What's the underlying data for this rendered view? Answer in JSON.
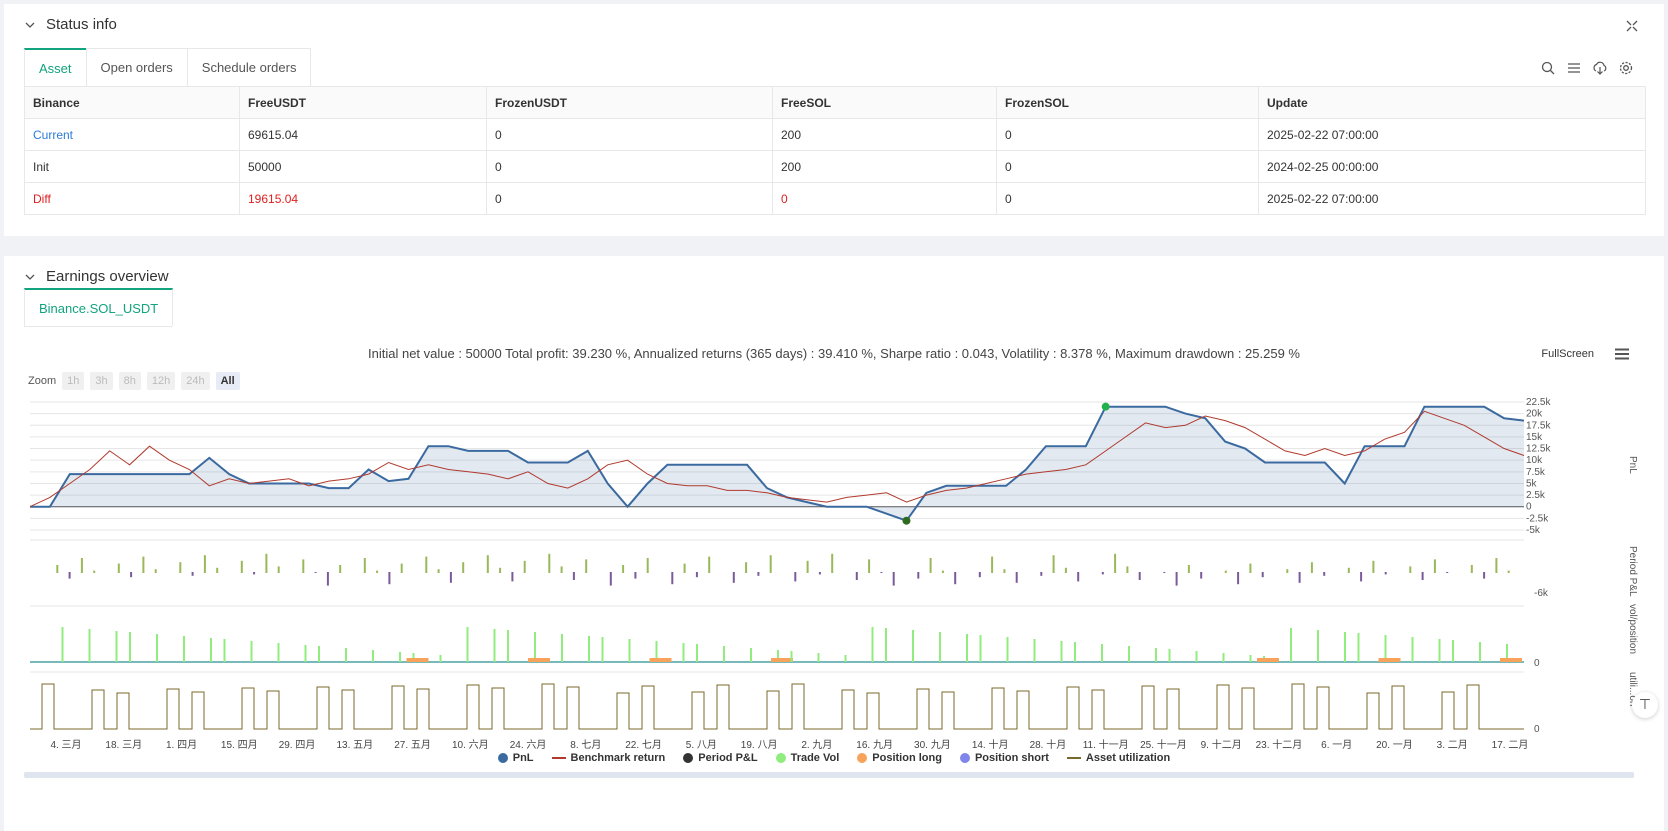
{
  "status_panel": {
    "title": "Status info",
    "tabs": [
      "Asset",
      "Open orders",
      "Schedule orders"
    ],
    "table": {
      "headers": [
        "Binance",
        "FreeUSDT",
        "FrozenUSDT",
        "FreeSOL",
        "FrozenSOL",
        "Update"
      ],
      "rows": [
        [
          "Current",
          "69615.04",
          "0",
          "200",
          "0",
          "2025-02-22 07:00:00"
        ],
        [
          "Init",
          "50000",
          "0",
          "200",
          "0",
          "2024-02-25 00:00:00"
        ],
        [
          "Diff",
          "19615.04",
          "0",
          "0",
          "0",
          "2025-02-22 07:00:00"
        ]
      ]
    },
    "icons": [
      "search-icon",
      "list-icon",
      "download-icon",
      "gear-icon"
    ]
  },
  "earnings_panel": {
    "title": "Earnings overview",
    "tab": "Binance.SOL_USDT",
    "summary": "Initial net value : 50000 Total profit: 39.230 %, Annualized returns (365 days) : 39.410 %, Sharpe ratio : 0.043, Volatility : 8.378 %, Maximum drawdown : 25.259 %",
    "fullscreen_label": "FullScreen",
    "zoom_label": "Zoom",
    "zoom_options": [
      "1h",
      "3h",
      "8h",
      "12h",
      "24h",
      "All"
    ],
    "zoom_active": "All",
    "legend": [
      {
        "label": "PnL",
        "color": "#3b6aa0",
        "shape": "dot"
      },
      {
        "label": "Benchmark return",
        "color": "#b03a2e",
        "shape": "line"
      },
      {
        "label": "Period P&L",
        "color": "#333333",
        "shape": "dot"
      },
      {
        "label": "Trade Vol",
        "color": "#90ed7d",
        "shape": "dot"
      },
      {
        "label": "Position long",
        "color": "#f7a35c",
        "shape": "dot"
      },
      {
        "label": "Position short",
        "color": "#8085e9",
        "shape": "dot"
      },
      {
        "label": "Asset utilization",
        "color": "#7a6a2a",
        "shape": "line"
      }
    ]
  },
  "chart_data": {
    "type": "line",
    "x_ticks": [
      "4. 三月",
      "18. 三月",
      "1. 四月",
      "15. 四月",
      "29. 四月",
      "13. 五月",
      "27. 五月",
      "10. 六月",
      "24. 六月",
      "8. 七月",
      "22. 七月",
      "5. 八月",
      "19. 八月",
      "2. 九月",
      "16. 九月",
      "30. 九月",
      "14. 十月",
      "28. 十月",
      "11. 十一月",
      "25. 十一月",
      "9. 十二月",
      "23. 十二月",
      "6. 一月",
      "20. 一月",
      "3. 二月",
      "17. 二月"
    ],
    "pnl_axis": {
      "label": "PnL",
      "ticks": [
        "22.5k",
        "20k",
        "17.5k",
        "15k",
        "12.5k",
        "10k",
        "7.5k",
        "5k",
        "2.5k",
        "0",
        "-2.5k",
        "-5k"
      ],
      "ylim": [
        -5000,
        22500
      ]
    },
    "period_axis": {
      "label": "Period P&L",
      "ticks": [
        "-6k"
      ]
    },
    "vol_axis": {
      "label": "vol/position",
      "ticks": [
        "0"
      ]
    },
    "util_axis": {
      "label": "utili...on",
      "ticks": [
        "0"
      ]
    },
    "pnl_series": [
      0,
      0,
      7000,
      7000,
      7000,
      7000,
      7000,
      7000,
      7000,
      10500,
      7000,
      5000,
      5000,
      5000,
      5000,
      4000,
      4000,
      8000,
      5500,
      6000,
      13000,
      13000,
      12000,
      12000,
      12000,
      9500,
      9500,
      9500,
      12000,
      5000,
      0,
      5000,
      9000,
      9000,
      9000,
      9000,
      9000,
      4000,
      2000,
      1000,
      0,
      0,
      0,
      -1500,
      -3000,
      3000,
      4500,
      4500,
      4500,
      4500,
      8000,
      13000,
      13000,
      13000,
      21500,
      21500,
      21500,
      21500,
      20000,
      19000,
      14000,
      12500,
      9500,
      9500,
      9500,
      9500,
      5000,
      13000,
      13000,
      13000,
      21500,
      21500,
      21500,
      21500,
      19000,
      18500
    ],
    "benchmark_series": [
      0,
      2000,
      5000,
      8000,
      12000,
      9000,
      13000,
      10000,
      8000,
      4500,
      6000,
      5000,
      5500,
      6000,
      4500,
      5500,
      6000,
      7000,
      9500,
      8000,
      9000,
      8000,
      7500,
      7000,
      6000,
      7500,
      5000,
      4000,
      6000,
      9000,
      10000,
      7000,
      5000,
      4500,
      4500,
      3500,
      3500,
      3000,
      2000,
      1500,
      1000,
      2000,
      2500,
      3000,
      1000,
      2500,
      3500,
      4000,
      5000,
      6000,
      7000,
      7500,
      8000,
      9000,
      12000,
      15000,
      18000,
      17000,
      17500,
      19500,
      18500,
      17000,
      14500,
      12000,
      11000,
      12500,
      11000,
      12000,
      14500,
      16000,
      20500,
      19000,
      17500,
      15000,
      12500,
      11000
    ]
  }
}
